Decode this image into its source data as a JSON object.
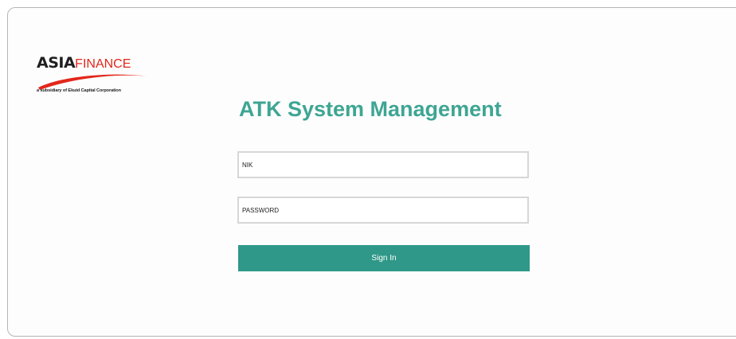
{
  "brand": {
    "name_part1": "ASIA",
    "name_part2": "FINANCE",
    "tagline": "a subsidiary of Ekuid Capital Corporation",
    "colors": {
      "dark": "#1f1f1f",
      "red": "#e2271b"
    }
  },
  "page": {
    "title": "ATK System Management"
  },
  "form": {
    "nik_placeholder": "NIK",
    "password_placeholder": "PASSWORD",
    "signin_label": "Sign In"
  },
  "colors": {
    "accent": "#3ea593",
    "button": "#2f9888",
    "field_border": "#d7d7d7"
  }
}
